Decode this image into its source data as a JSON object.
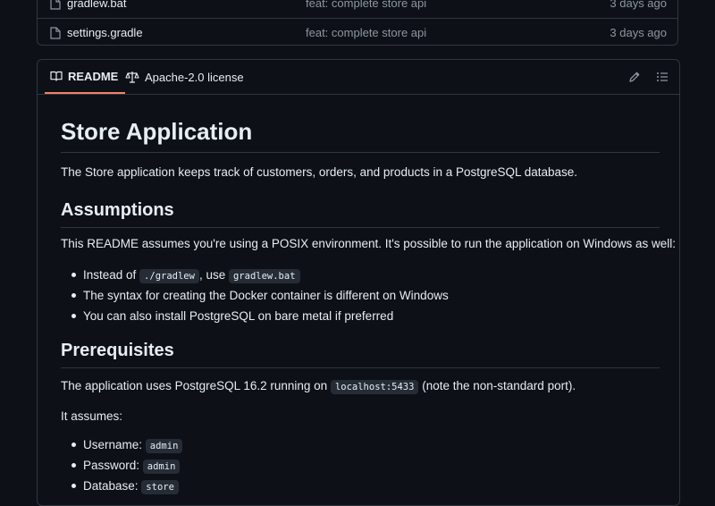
{
  "files": [
    {
      "name": "gradlew.bat",
      "message": "feat: complete store api",
      "date": "3 days ago"
    },
    {
      "name": "settings.gradle",
      "message": "feat: complete store api",
      "date": "3 days ago"
    }
  ],
  "readme_tabs": {
    "readme": "README",
    "license": "Apache-2.0 license"
  },
  "readme": {
    "title": "Store Application",
    "intro": "The Store application keeps track of customers, orders, and products in a PostgreSQL database.",
    "assumptions_heading": "Assumptions",
    "assumptions_text": "This README assumes you're using a POSIX environment. It's possible to run the application on Windows as well:",
    "assumptions_list": {
      "item1_prefix": "Instead of ",
      "item1_code1": "./gradlew",
      "item1_mid": ", use ",
      "item1_code2": "gradlew.bat",
      "item2": "The syntax for creating the Docker container is different on Windows",
      "item3": "You can also install PostgreSQL on bare metal if preferred"
    },
    "prerequisites_heading": "Prerequisites",
    "prereq_prefix": "The application uses PostgreSQL 16.2 running on ",
    "prereq_code": "localhost:5433",
    "prereq_suffix": " (note the non-standard port).",
    "it_assumes": "It assumes:",
    "assumes_list": [
      {
        "label": "Username: ",
        "value": "admin"
      },
      {
        "label": "Password: ",
        "value": "admin"
      },
      {
        "label": "Database: ",
        "value": "store"
      }
    ]
  },
  "colors": {
    "background": "#0d1117",
    "border": "#30363d",
    "muted_text": "#8d96a0",
    "active_tab_underline": "#f78166"
  },
  "icons": {
    "file": "file-icon",
    "book": "book-icon",
    "law": "law-icon",
    "edit": "pencil-icon",
    "outline": "list-unordered-icon"
  }
}
